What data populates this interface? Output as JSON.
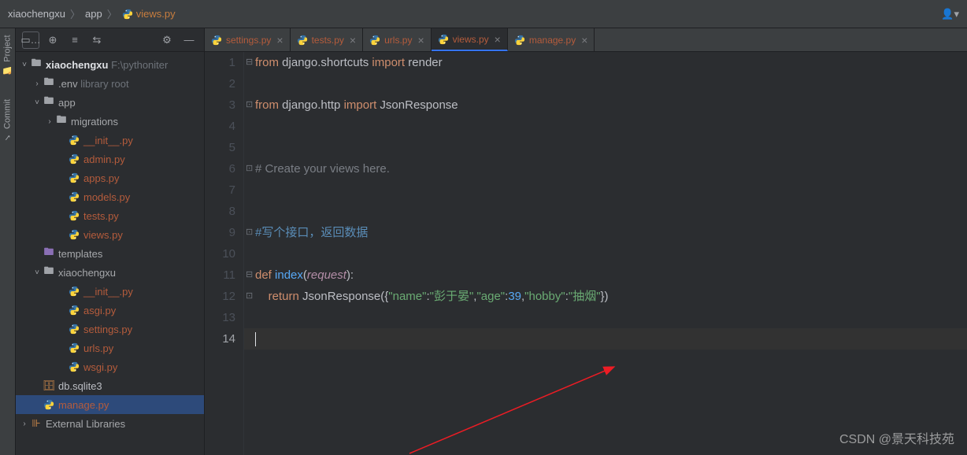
{
  "breadcrumb": {
    "seg1": "xiaochengxu",
    "seg2": "app",
    "file": "views.py"
  },
  "sidebar": {
    "tabs": [
      "Project",
      "Commit"
    ]
  },
  "tree": {
    "root": "xiaochengxu",
    "root_path": "F:\\pythoniter",
    "env": ".env",
    "env_hint": "library root",
    "app": "app",
    "migrations": "migrations",
    "files_app": [
      "__init__.py",
      "admin.py",
      "apps.py",
      "models.py",
      "tests.py",
      "views.py"
    ],
    "templates": "templates",
    "pkg": "xiaochengxu",
    "files_pkg": [
      "__init__.py",
      "asgi.py",
      "settings.py",
      "urls.py",
      "wsgi.py"
    ],
    "db": "db.sqlite3",
    "manage": "manage.py",
    "ext": "External Libraries"
  },
  "tabs": [
    {
      "label": "settings.py",
      "active": false
    },
    {
      "label": "tests.py",
      "active": false
    },
    {
      "label": "urls.py",
      "active": false
    },
    {
      "label": "views.py",
      "active": true
    },
    {
      "label": "manage.py",
      "active": false
    }
  ],
  "code": {
    "lines": [
      {
        "n": 1,
        "seg": [
          {
            "t": "from ",
            "c": "kw"
          },
          {
            "t": "django.shortcuts ",
            "c": ""
          },
          {
            "t": "import ",
            "c": "kw"
          },
          {
            "t": "render",
            "c": ""
          }
        ],
        "fold": "⊟"
      },
      {
        "n": 2,
        "seg": []
      },
      {
        "n": 3,
        "seg": [
          {
            "t": "from ",
            "c": "kw"
          },
          {
            "t": "django.http ",
            "c": ""
          },
          {
            "t": "import ",
            "c": "kw"
          },
          {
            "t": "JsonResponse",
            "c": ""
          }
        ],
        "fold": "⊡"
      },
      {
        "n": 4,
        "seg": []
      },
      {
        "n": 5,
        "seg": []
      },
      {
        "n": 6,
        "seg": [
          {
            "t": "# Create your views here.",
            "c": "com"
          }
        ],
        "fold": "⊡"
      },
      {
        "n": 7,
        "seg": []
      },
      {
        "n": 8,
        "seg": []
      },
      {
        "n": 9,
        "seg": [
          {
            "t": "#写个接口，返回数据",
            "c": "comx"
          }
        ],
        "fold": "⊡"
      },
      {
        "n": 10,
        "seg": []
      },
      {
        "n": 11,
        "seg": [
          {
            "t": "def ",
            "c": "kw"
          },
          {
            "t": "index",
            "c": "fn"
          },
          {
            "t": "(",
            "c": ""
          },
          {
            "t": "request",
            "c": "pm"
          },
          {
            "t": "):",
            "c": ""
          }
        ],
        "fold": "⊟"
      },
      {
        "n": 12,
        "seg": [
          {
            "t": "    ",
            "c": ""
          },
          {
            "t": "return ",
            "c": "kw"
          },
          {
            "t": "JsonResponse",
            "c": "cls"
          },
          {
            "t": "({",
            "c": ""
          },
          {
            "t": "\"name\"",
            "c": "str"
          },
          {
            "t": ":",
            "c": ""
          },
          {
            "t": "\"彭于晏\"",
            "c": "str"
          },
          {
            "t": ",",
            "c": ""
          },
          {
            "t": "\"age\"",
            "c": "str"
          },
          {
            "t": ":",
            "c": ""
          },
          {
            "t": "39",
            "c": "num"
          },
          {
            "t": ",",
            "c": ""
          },
          {
            "t": "\"hobby\"",
            "c": "str"
          },
          {
            "t": ":",
            "c": ""
          },
          {
            "t": "\"抽烟\"",
            "c": "str"
          },
          {
            "t": "})",
            "c": ""
          }
        ],
        "fold": "⊡"
      },
      {
        "n": 13,
        "seg": []
      },
      {
        "n": 14,
        "seg": [],
        "active": true,
        "caret": true
      }
    ]
  },
  "watermark": "CSDN @景天科技苑"
}
